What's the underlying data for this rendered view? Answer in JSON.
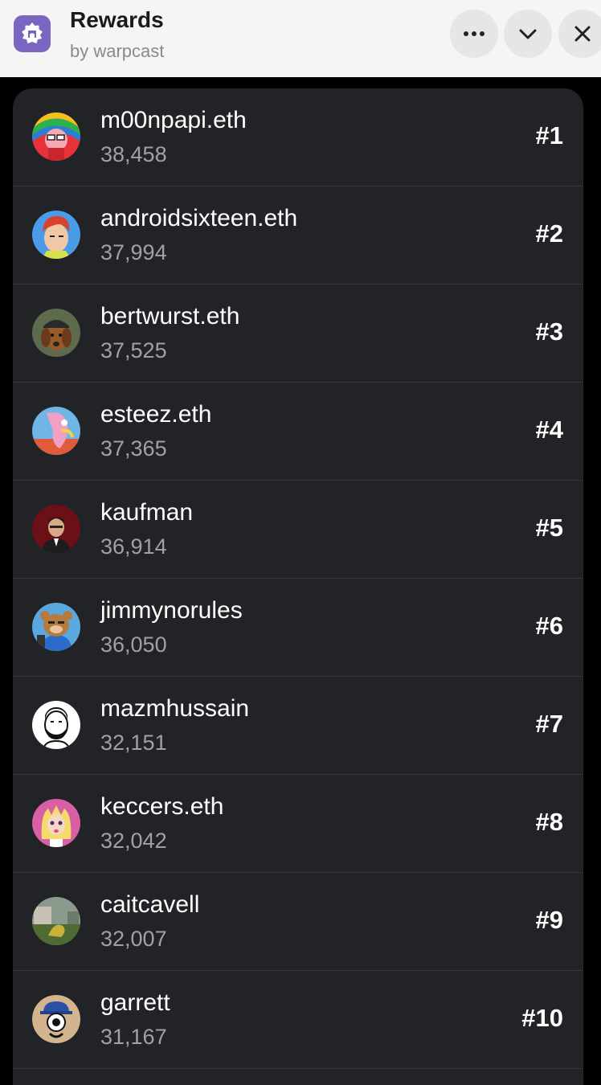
{
  "header": {
    "title": "Rewards",
    "subtitle": "by warpcast",
    "app_icon": "warpcast-arch-icon",
    "brand_color": "#7c65c1",
    "buttons": [
      "more-icon",
      "chevron-down-icon",
      "close-icon"
    ]
  },
  "leaderboard": {
    "rows": [
      {
        "name": "m00npapi.eth",
        "score": "38,458",
        "rank": "#1"
      },
      {
        "name": "androidsixteen.eth",
        "score": "37,994",
        "rank": "#2"
      },
      {
        "name": "bertwurst.eth",
        "score": "37,525",
        "rank": "#3"
      },
      {
        "name": "esteez.eth",
        "score": "37,365",
        "rank": "#4"
      },
      {
        "name": "kaufman",
        "score": "36,914",
        "rank": "#5"
      },
      {
        "name": "jimmynorules",
        "score": "36,050",
        "rank": "#6"
      },
      {
        "name": "mazmhussain",
        "score": "32,151",
        "rank": "#7"
      },
      {
        "name": "keccers.eth",
        "score": "32,042",
        "rank": "#8"
      },
      {
        "name": "caitcavell",
        "score": "32,007",
        "rank": "#9"
      },
      {
        "name": "garrett",
        "score": "31,167",
        "rank": "#10"
      }
    ]
  }
}
